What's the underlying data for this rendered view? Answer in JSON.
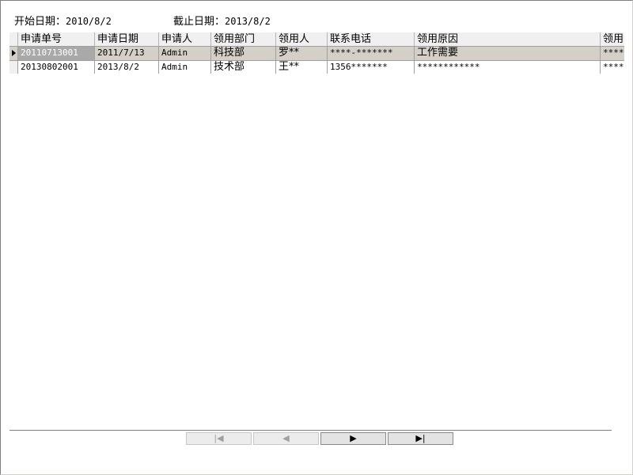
{
  "filter": {
    "start_label": "开始日期：",
    "start_value": "2010/8/2",
    "end_label": "截止日期：",
    "end_value": "2013/8/2"
  },
  "table": {
    "columns": [
      "申请单号",
      "申请日期",
      "申请人",
      "领用部门",
      "领用人",
      "联系电话",
      "领用原因",
      "领用"
    ],
    "rows": [
      [
        "20110713001",
        "2011/7/13",
        "Admin",
        "科技部",
        "罗**",
        "****-*******",
        "工作需要",
        "****"
      ],
      [
        "20130802001",
        "2013/8/2",
        "Admin",
        "技术部",
        "王**",
        "1356*******",
        "************",
        "****"
      ]
    ],
    "selected_row": 0
  },
  "pager": {
    "first": "|◀",
    "prev": "◀",
    "next": "▶",
    "last": "▶|"
  }
}
